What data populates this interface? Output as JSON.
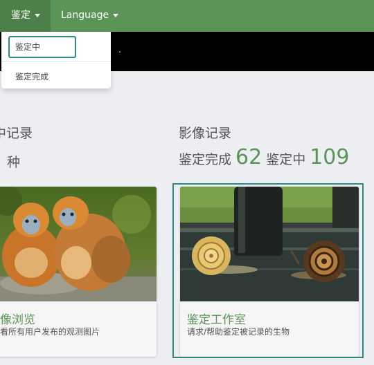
{
  "nav": {
    "identify_label": "鉴定",
    "language_label": "Language"
  },
  "dropdown": {
    "items": [
      {
        "label": "鉴定中"
      },
      {
        "label": "鉴定完成"
      }
    ]
  },
  "left_section": {
    "title_fragment": "中记录",
    "count_fragment": "种"
  },
  "right_section": {
    "title": "影像记录",
    "done_label": "鉴定完成",
    "done_count": "62",
    "pending_label": "鉴定中",
    "pending_count": "109"
  },
  "cards": [
    {
      "title": "像浏览",
      "desc": "看所有用户发布的观测图片",
      "image": "golden-snub-nosed-monkeys"
    },
    {
      "title": "鉴定工作室",
      "desc": "请求/帮助鉴定被记录的生物",
      "image": "snails-on-railing"
    }
  ],
  "colors": {
    "navbar": "#5a9456",
    "accent_green": "#5a9456",
    "focus_outline": "#2a8a84"
  }
}
